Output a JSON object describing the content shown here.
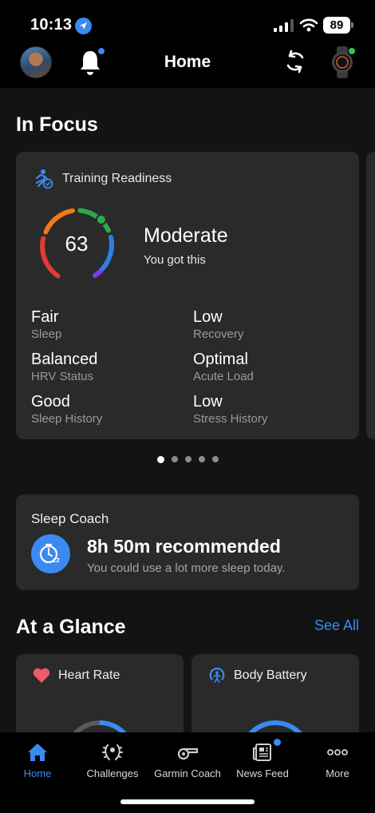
{
  "status_bar": {
    "time": "10:13",
    "battery": "89"
  },
  "header": {
    "title": "Home"
  },
  "in_focus": {
    "section_title": "In Focus",
    "card": {
      "title": "Training Readiness",
      "score": "63",
      "status": "Moderate",
      "status_sub": "You got this",
      "metrics": [
        {
          "value": "Fair",
          "label": "Sleep"
        },
        {
          "value": "Low",
          "label": "Recovery"
        },
        {
          "value": "Balanced",
          "label": "HRV Status"
        },
        {
          "value": "Optimal",
          "label": "Acute Load"
        },
        {
          "value": "Good",
          "label": "Sleep History"
        },
        {
          "value": "Low",
          "label": "Stress History"
        }
      ]
    },
    "pagination": {
      "count": 5,
      "active": 1
    }
  },
  "sleep_coach": {
    "title": "Sleep Coach",
    "recommendation": "8h 50m recommended",
    "message": "You could use a lot more sleep today."
  },
  "at_a_glance": {
    "section_title": "At a Glance",
    "see_all": "See All",
    "cards": [
      {
        "label": "Heart Rate",
        "icon": "heart-icon"
      },
      {
        "label": "Body Battery",
        "icon": "body-battery-icon"
      }
    ]
  },
  "bottom_nav": {
    "items": [
      {
        "label": "Home",
        "icon": "home-icon",
        "active": true
      },
      {
        "label": "Challenges",
        "icon": "laurel-icon",
        "active": false
      },
      {
        "label": "Garmin Coach",
        "icon": "whistle-icon",
        "active": false
      },
      {
        "label": "News Feed",
        "icon": "news-icon",
        "active": false
      },
      {
        "label": "More",
        "icon": "more-icon",
        "active": false
      }
    ]
  },
  "colors": {
    "accent": "#3a8af0",
    "background": "#131313",
    "card": "#2a2a2a",
    "gauge_red": "#e53935",
    "gauge_orange": "#f07a1a",
    "gauge_green": "#2fa84f",
    "gauge_blue": "#2d7fe0",
    "gauge_purple": "#7a3cf0"
  }
}
